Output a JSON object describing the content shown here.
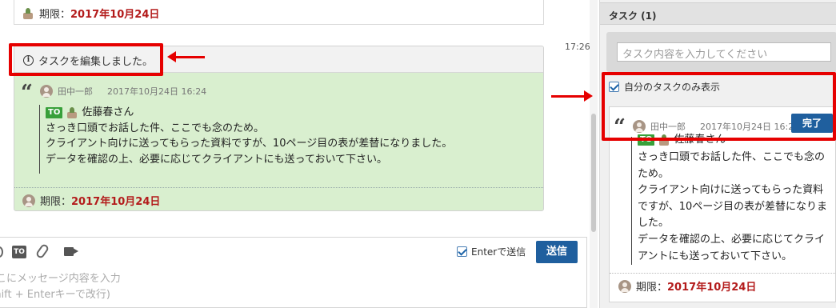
{
  "previous_message": {
    "deadline_label": "期限：",
    "deadline_date": "2017年10月24日"
  },
  "timestamp": "17:26",
  "task_message": {
    "header_text": "タスクを編集しました。",
    "author": "田中一郎",
    "datetime": "2017年10月24日 16:24",
    "to_badge": "TO",
    "recipient": "佐藤春さん",
    "body_lines": [
      "さっき口頭でお話した件、ここでも念のため。",
      "クライアント向けに送ってもらった資料ですが、10ページ目の表が差替になりました。",
      "データを確認の上、必要に応じてクライアントにも送っておいて下さい。"
    ],
    "deadline_label": "期限：",
    "deadline_date": "2017年10月24日"
  },
  "composer": {
    "to_icon": "TO",
    "enter_send_label": "Enterで送信",
    "enter_send_checked": true,
    "send_label": "送信",
    "placeholder_line1": "ここにメッセージ内容を入力",
    "placeholder_line2": "(Shift + Enterキーで改行)"
  },
  "task_panel": {
    "title": "タスク (1)",
    "input_placeholder": "タスク内容を入力してください",
    "my_tasks_only_label": "自分のタスクのみ表示",
    "my_tasks_only_checked": true,
    "task": {
      "author": "田中一郎",
      "datetime": "2017年10月24日 16:24",
      "done_label": "完了",
      "to_badge": "TO",
      "recipient": "佐藤春さん",
      "body_lines": [
        "さっき口頭でお話した件、ここでも念の",
        "ため。",
        "クライアント向けに送ってもらった資料",
        "ですが、10ページ目の表が差替になりま",
        "した。",
        "データを確認の上、必要に応じてクライ",
        "アントにも送っておいて下さい。"
      ],
      "deadline_label": "期限：",
      "deadline_date": "2017年10月24日"
    }
  },
  "colors": {
    "deadline": "#b31b1b",
    "task_bg": "#d9efcf",
    "button_blue": "#1f5f9e",
    "annotation_red": "#e60000",
    "to_badge_green": "#38a03a"
  }
}
